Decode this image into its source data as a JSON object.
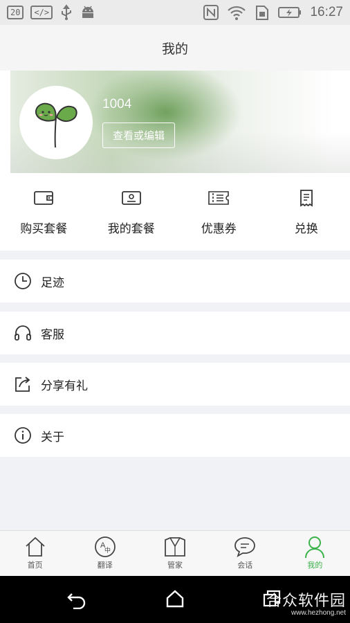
{
  "status_bar": {
    "notification_count": "20",
    "debug_icon": "</>",
    "time": "16:27",
    "icons": [
      "notification-count-icon",
      "debug-icon",
      "usb-icon",
      "android-icon",
      "nfc-icon",
      "wifi-icon",
      "sim-icon",
      "battery-charging-icon"
    ]
  },
  "header": {
    "title": "我的"
  },
  "profile": {
    "username": "1004",
    "edit_label": "查看或编辑"
  },
  "actions": [
    {
      "label": "购买套餐",
      "icon": "wallet-icon"
    },
    {
      "label": "我的套餐",
      "icon": "id-card-icon"
    },
    {
      "label": "优惠券",
      "icon": "coupon-icon"
    },
    {
      "label": "兑换",
      "icon": "receipt-icon"
    }
  ],
  "menu": [
    {
      "label": "足迹",
      "icon": "clock-icon"
    },
    {
      "label": "客服",
      "icon": "headset-icon"
    },
    {
      "label": "分享有礼",
      "icon": "share-icon"
    },
    {
      "label": "关于",
      "icon": "info-icon"
    }
  ],
  "bottom_nav": [
    {
      "label": "首页",
      "icon": "home-icon",
      "active": false
    },
    {
      "label": "翻译",
      "icon": "translate-icon",
      "active": false
    },
    {
      "label": "管家",
      "icon": "butler-icon",
      "active": false
    },
    {
      "label": "会话",
      "icon": "chat-icon",
      "active": false
    },
    {
      "label": "我的",
      "icon": "profile-icon",
      "active": true
    }
  ],
  "colors": {
    "accent": "#3bb24a",
    "page_bg": "#f1f2f6",
    "sprout_green": "#6aaa4a"
  },
  "watermark": {
    "title": "合众软件园",
    "url": "www.hezhong.net"
  }
}
